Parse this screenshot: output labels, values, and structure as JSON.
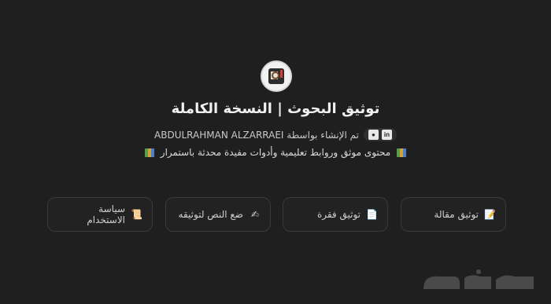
{
  "header": {
    "title": "توثيق البحوث | النسخة الكاملة",
    "author_text": "تم الإنشاء بواسطة ABDULRAHMAN ALZARRAEI",
    "social_icons": [
      "linkedin-icon",
      "github-icon"
    ],
    "tagline": "محتوى موثق وروابط تعليمية وأدوات مفيدة محدثة باستمرار",
    "tagline_icon": "books-icon"
  },
  "cards": [
    {
      "label": "توثيق مقالة",
      "icon": "memo-icon",
      "glyph": "📝"
    },
    {
      "label": "توثيق فقرة",
      "icon": "page-icon",
      "glyph": "📄"
    },
    {
      "label": "ضع النص لتوثيقه",
      "icon": "writing-hand-icon",
      "glyph": "✍"
    },
    {
      "label": "سياسة الاستخدام",
      "icon": "scroll-icon",
      "glyph": "📜"
    }
  ],
  "watermark": {
    "text": "حراج"
  },
  "colors": {
    "background": "#1f1f1f",
    "card_border": "#3a3a3a",
    "text": "#e6e6e6"
  }
}
